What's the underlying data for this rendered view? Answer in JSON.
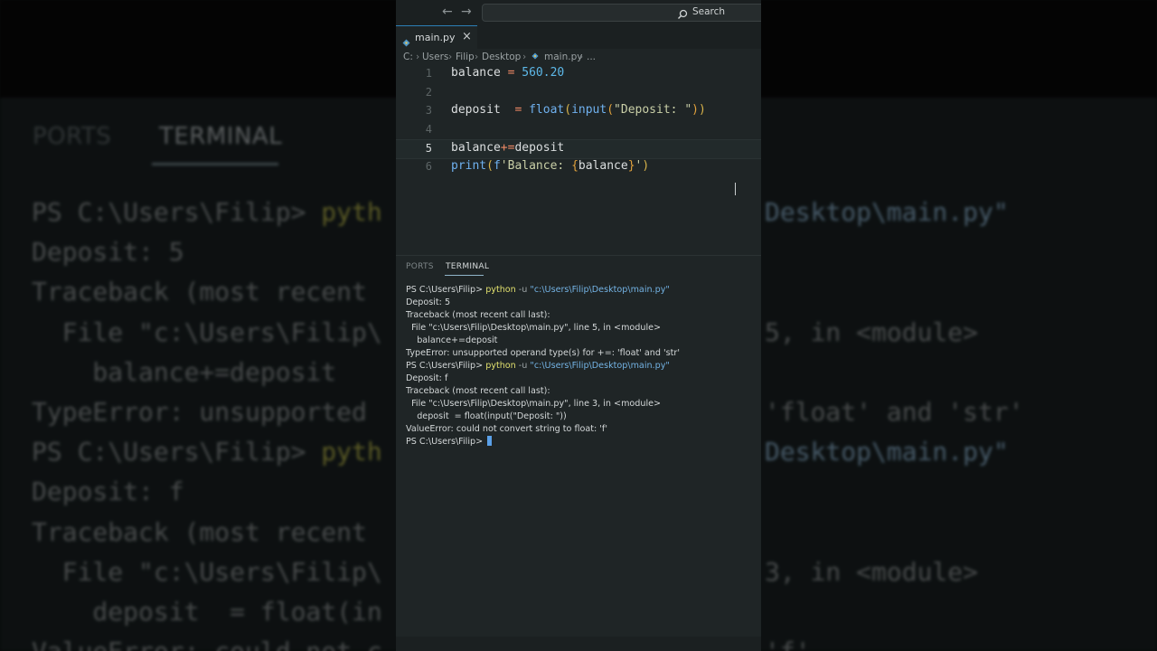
{
  "background": {
    "tabs": [
      "PORTS",
      "TERMINAL"
    ],
    "lines": [
      {
        "parts": [
          {
            "t": "PS C:\\Users\\Filip> "
          },
          {
            "t": "pyth",
            "c": "y"
          }
        ],
        "right": [
          {
            "t": "Desktop\\main.py\"",
            "c": "s"
          }
        ]
      },
      {
        "parts": [
          {
            "t": "Deposit: 5"
          }
        ]
      },
      {
        "parts": [
          {
            "t": "Traceback (most recent "
          }
        ]
      },
      {
        "parts": [
          {
            "t": "  File \"c:\\Users\\Filip\\"
          }
        ],
        "right": [
          {
            "t": "5, in <module>"
          }
        ]
      },
      {
        "parts": [
          {
            "t": "    balance+=deposit"
          }
        ]
      },
      {
        "parts": [
          {
            "t": "TypeError: unsupported "
          }
        ],
        "right": [
          {
            "t": "'float' and 'str'"
          }
        ]
      },
      {
        "parts": [
          {
            "t": "PS C:\\Users\\Filip> "
          },
          {
            "t": "pyth",
            "c": "y"
          }
        ],
        "right": [
          {
            "t": "Desktop\\main.py\"",
            "c": "s"
          }
        ]
      },
      {
        "parts": [
          {
            "t": "Deposit: f"
          }
        ]
      },
      {
        "parts": [
          {
            "t": "Traceback (most recent "
          }
        ]
      },
      {
        "parts": [
          {
            "t": "  File \"c:\\Users\\Filip\\"
          }
        ],
        "right": [
          {
            "t": "3, in <module>"
          }
        ]
      },
      {
        "parts": [
          {
            "t": "    deposit  = float(in"
          }
        ]
      },
      {
        "parts": [
          {
            "t": "ValueError: could not c"
          }
        ],
        "right": [
          {
            "t": "'f'"
          }
        ]
      }
    ]
  },
  "search": {
    "label": "Search"
  },
  "tab": {
    "label": "main.py",
    "close": "×"
  },
  "breadcrumb": {
    "items": [
      "C:",
      "Users",
      "Filip",
      "Desktop",
      "main.py",
      "..."
    ]
  },
  "editor": {
    "current_line": 5,
    "lines": [
      {
        "n": "1",
        "tokens": [
          {
            "t": "balance",
            "c": "var"
          },
          {
            "t": " = ",
            "c": "op"
          },
          {
            "t": "560.20",
            "c": "num"
          }
        ]
      },
      {
        "n": "2",
        "tokens": []
      },
      {
        "n": "3",
        "tokens": [
          {
            "t": "deposit",
            "c": "var"
          },
          {
            "t": "  = ",
            "c": "op"
          },
          {
            "t": "float",
            "c": "fn"
          },
          {
            "t": "(",
            "c": "punc"
          },
          {
            "t": "input",
            "c": "fn"
          },
          {
            "t": "(",
            "c": "brace"
          },
          {
            "t": "\"Deposit: \"",
            "c": "str"
          },
          {
            "t": ")",
            "c": "brace"
          },
          {
            "t": ")",
            "c": "punc"
          }
        ]
      },
      {
        "n": "4",
        "tokens": []
      },
      {
        "n": "5",
        "tokens": [
          {
            "t": "balance",
            "c": "var"
          },
          {
            "t": "+=",
            "c": "op"
          },
          {
            "t": "deposit",
            "c": "var"
          }
        ]
      },
      {
        "n": "6",
        "tokens": [
          {
            "t": "print",
            "c": "fn"
          },
          {
            "t": "(",
            "c": "punc"
          },
          {
            "t": "f",
            "c": "fn"
          },
          {
            "t": "'Balance: ",
            "c": "str"
          },
          {
            "t": "{",
            "c": "brace"
          },
          {
            "t": "balance",
            "c": "var"
          },
          {
            "t": "}",
            "c": "brace"
          },
          {
            "t": "'",
            "c": "str"
          },
          {
            "t": ")",
            "c": "punc"
          }
        ]
      }
    ]
  },
  "panel": {
    "tabs": [
      "PORTS",
      "TERMINAL"
    ],
    "active": "TERMINAL"
  },
  "terminal": {
    "lines": [
      [
        {
          "t": "PS C:\\Users\\Filip> "
        },
        {
          "t": "python",
          "c": "cmd"
        },
        {
          "t": " -u ",
          "c": "flag"
        },
        {
          "t": "\"c:\\Users\\Filip\\Desktop\\main.py\"",
          "c": "path"
        }
      ],
      [
        {
          "t": "Deposit: 5"
        }
      ],
      [
        {
          "t": "Traceback (most recent call last):"
        }
      ],
      [
        {
          "t": "  File \"c:\\Users\\Filip\\Desktop\\main.py\", line 5, in <module>"
        }
      ],
      [
        {
          "t": "    balance+=deposit"
        }
      ],
      [
        {
          "t": "TypeError: unsupported operand type(s) for +=: 'float' and 'str'"
        }
      ],
      [
        {
          "t": "PS C:\\Users\\Filip> "
        },
        {
          "t": "python",
          "c": "cmd"
        },
        {
          "t": " -u ",
          "c": "flag"
        },
        {
          "t": "\"c:\\Users\\Filip\\Desktop\\main.py\"",
          "c": "path"
        }
      ],
      [
        {
          "t": "Deposit: f"
        }
      ],
      [
        {
          "t": "Traceback (most recent call last):"
        }
      ],
      [
        {
          "t": "  File \"c:\\Users\\Filip\\Desktop\\main.py\", line 3, in <module>"
        }
      ],
      [
        {
          "t": "    deposit  = float(input(\"Deposit: \"))"
        }
      ],
      [
        {
          "t": "ValueError: could not convert string to float: 'f'"
        }
      ],
      [
        {
          "t": "PS C:\\Users\\Filip> "
        }
      ]
    ]
  },
  "colors": {
    "accent": "#2c7fb8",
    "cursor": "#5aa0e8",
    "background": "#1f2526"
  }
}
